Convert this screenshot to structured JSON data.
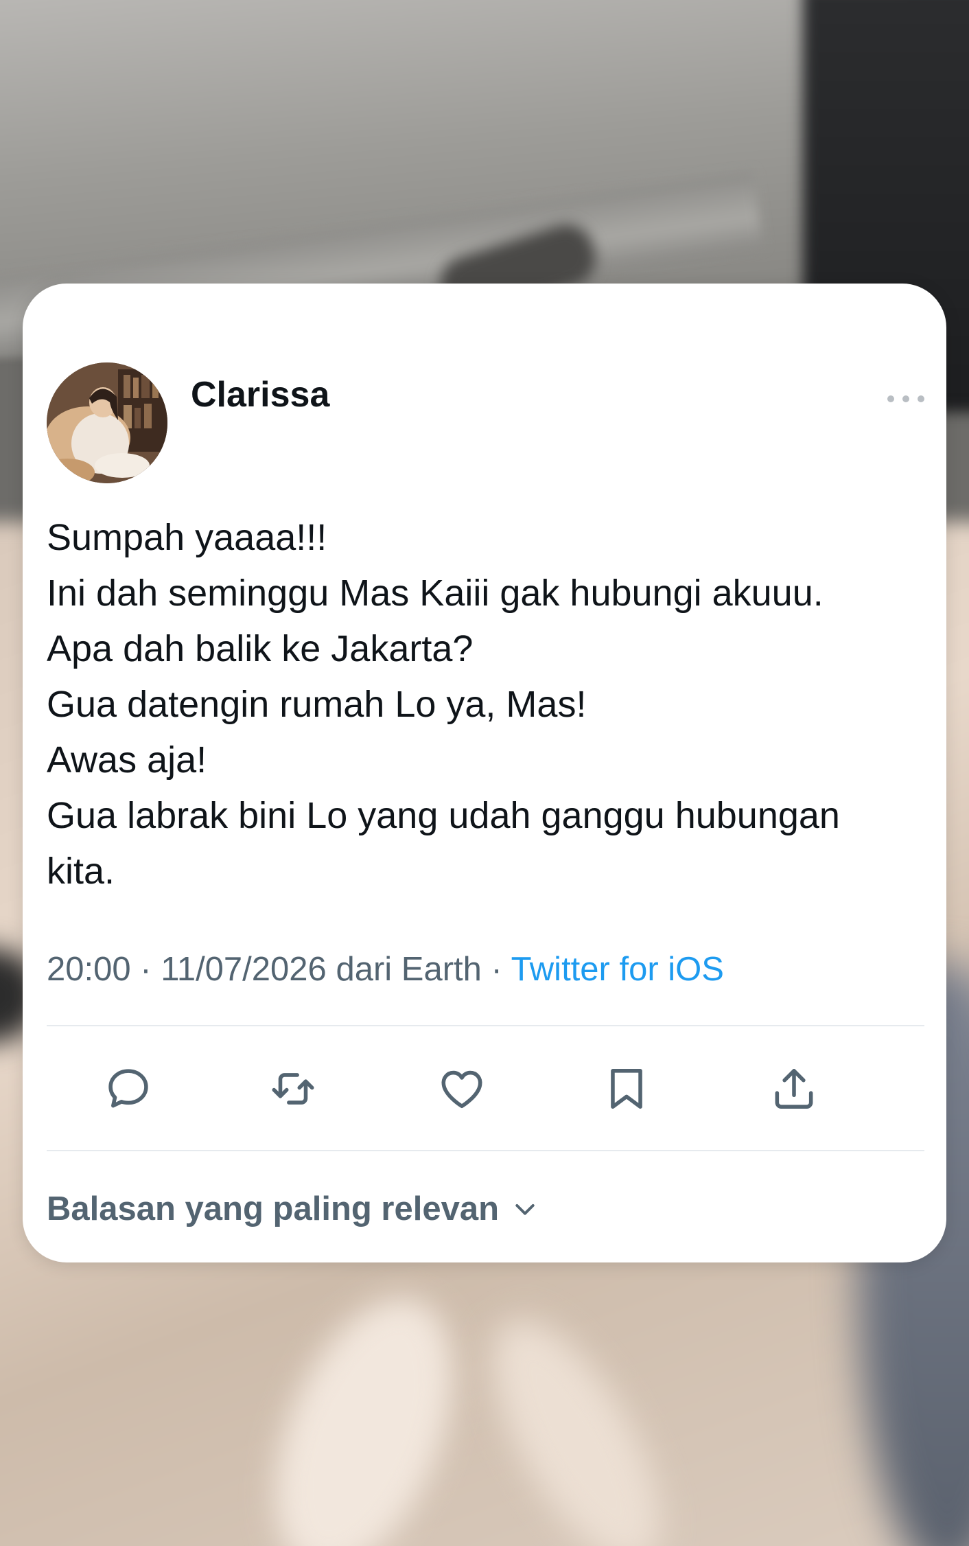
{
  "tweet": {
    "author": {
      "display_name": "Clarissa",
      "avatar_icon": "profile-photo"
    },
    "more_icon": "ellipsis-icon",
    "lines": [
      "Sumpah yaaaa!!!",
      "Ini dah seminggu Mas Kaiii gak hubungi akuuu.",
      "Apa dah balik ke Jakarta?",
      "Gua datengin rumah Lo ya, Mas!",
      "Awas aja!",
      "Gua labrak bini Lo yang udah ganggu hubungan",
      "kita."
    ],
    "meta": {
      "time": "20:00",
      "separator": "·",
      "date": "11/07/2026",
      "location": "dari Earth",
      "source": "Twitter for iOS"
    },
    "actions": [
      {
        "name": "reply",
        "icon": "reply-bubble-icon"
      },
      {
        "name": "retweet",
        "icon": "retweet-icon"
      },
      {
        "name": "like",
        "icon": "heart-icon"
      },
      {
        "name": "bookmark",
        "icon": "bookmark-icon"
      },
      {
        "name": "share",
        "icon": "share-icon"
      }
    ],
    "replies_sort_label": "Balasan yang paling relevan"
  },
  "colors": {
    "text_primary": "#0f1419",
    "text_secondary": "#536471",
    "link": "#1d9bf0",
    "divider": "#e6eaee",
    "card_background": "#ffffff"
  }
}
